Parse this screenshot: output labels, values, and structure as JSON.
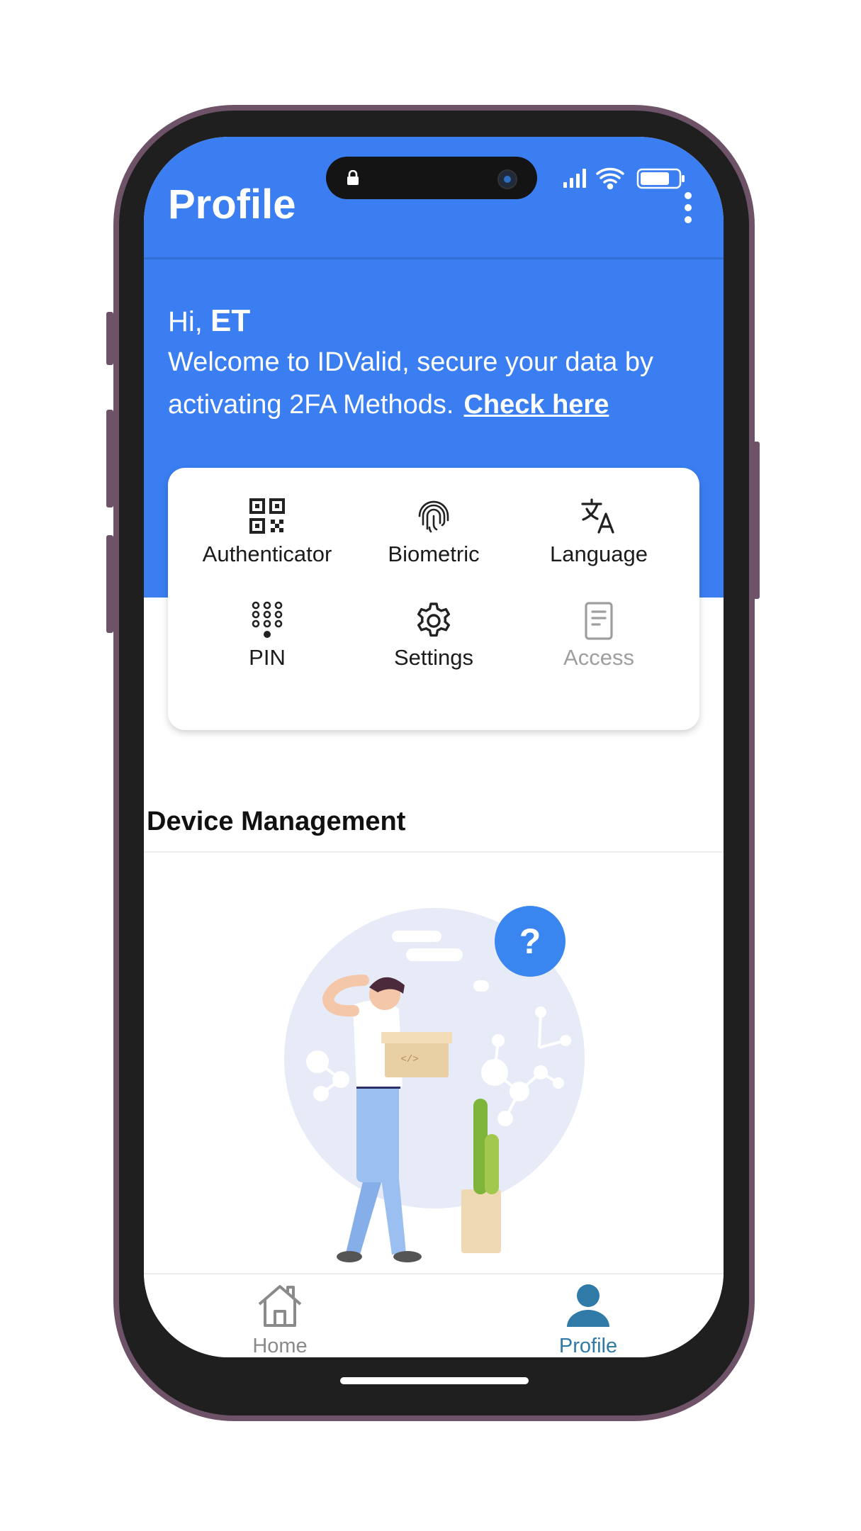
{
  "appbar": {
    "title": "Profile"
  },
  "hero": {
    "greeting_prefix": "Hi,",
    "user_name": "ET",
    "welcome_text": "Welcome to IDValid, secure your data by activating 2FA Methods.",
    "check_link": "Check here"
  },
  "menu": {
    "items": [
      {
        "label": "Authenticator",
        "icon": "qr-code-icon",
        "enabled": true
      },
      {
        "label": "Biometric",
        "icon": "fingerprint-icon",
        "enabled": true
      },
      {
        "label": "Language",
        "icon": "translate-icon",
        "enabled": true
      },
      {
        "label": "PIN",
        "icon": "keypad-icon",
        "enabled": true
      },
      {
        "label": "Settings",
        "icon": "gear-icon",
        "enabled": true
      },
      {
        "label": "Access",
        "icon": "document-icon",
        "enabled": false
      }
    ]
  },
  "section": {
    "title": "Device Management"
  },
  "bottom_nav": {
    "items": [
      {
        "label": "Home",
        "icon": "home-icon",
        "active": false
      },
      {
        "label": "Profile",
        "icon": "person-icon",
        "active": true
      }
    ]
  },
  "colors": {
    "primary": "#3a7ef1",
    "nav_active": "#2f7aa6",
    "nav_inactive": "#8a8a8a",
    "disabled": "#9e9e9e"
  }
}
